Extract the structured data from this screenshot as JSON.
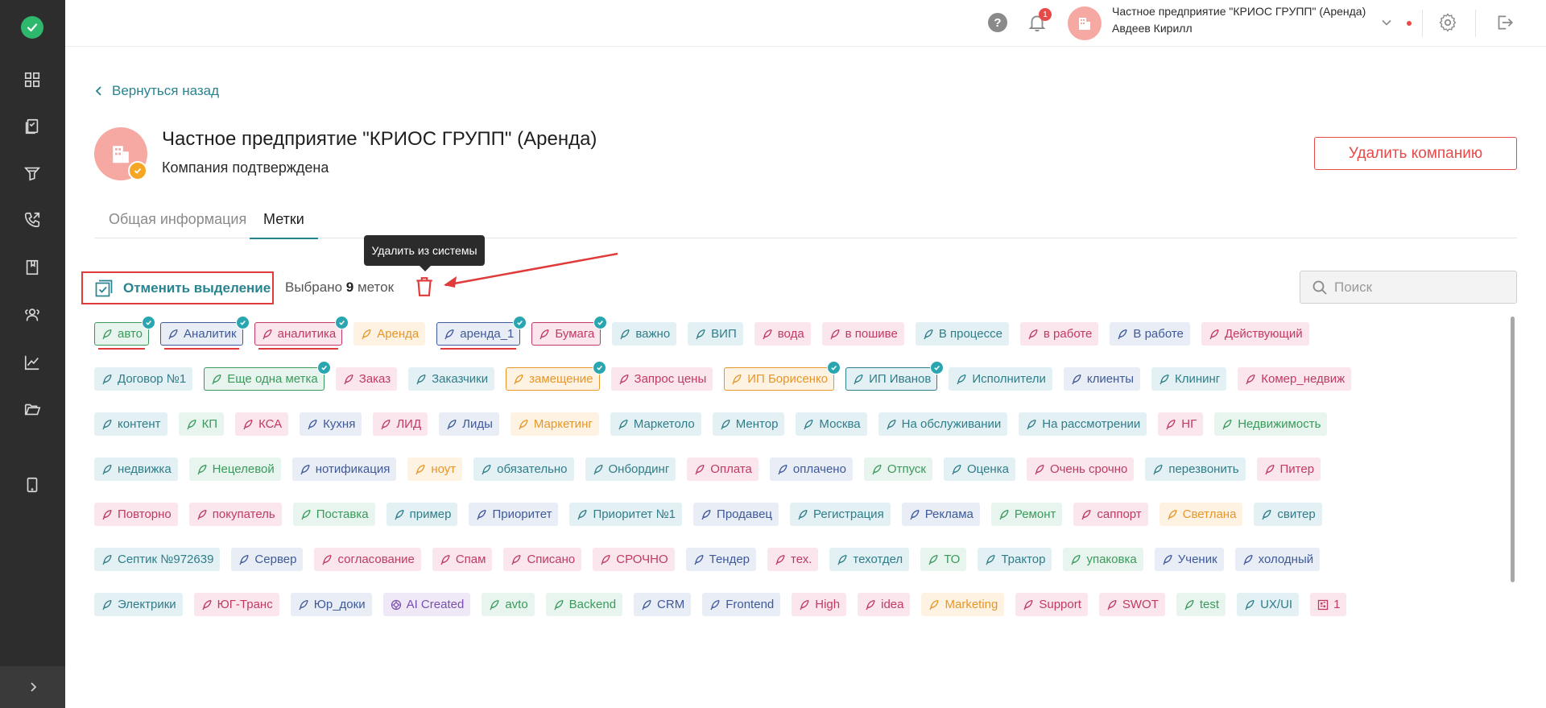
{
  "header": {
    "company_name": "Частное предприятие \"КРИОС ГРУПП\" (Аренда)",
    "user_name": "Авдеев Кирилл",
    "notification_count": "1",
    "help_label": "?"
  },
  "sidebar": {
    "icons": [
      "dashboard-icon",
      "documents-icon",
      "filter-icon",
      "phone-icon",
      "book-icon",
      "users-icon",
      "analytics-icon",
      "folder-icon",
      "mobile-icon"
    ]
  },
  "page": {
    "back_label": "Вернуться назад",
    "title": "Частное предприятие \"КРИОС ГРУПП\" (Аренда)",
    "status": "Компания подтверждена",
    "delete_company_label": "Удалить компанию",
    "tabs": [
      {
        "label": "Общая информация",
        "active": false
      },
      {
        "label": "Метки",
        "active": true
      }
    ],
    "cancel_selection_label": "Отменить выделение",
    "selected_prefix": "Выбрано ",
    "selected_count": "9",
    "selected_suffix": " меток",
    "tooltip": "Удалить из системы",
    "search_placeholder": "Поиск"
  },
  "colors": {
    "accent": "#27838f",
    "danger": "#e84a4a",
    "sidebar": "#2d2d2d",
    "success": "#2eb86e"
  },
  "tags": [
    [
      {
        "label": "авто",
        "color": "green",
        "selected": true,
        "underline": true
      },
      {
        "label": "Аналитик",
        "color": "blue",
        "selected": true,
        "underline": true
      },
      {
        "label": "аналитика",
        "color": "pink",
        "selected": true,
        "underline": true
      },
      {
        "label": "Аренда",
        "color": "orange"
      },
      {
        "label": "аренда_1",
        "color": "blue",
        "selected": true,
        "underline": true
      },
      {
        "label": "Бумага",
        "color": "pink",
        "selected": true
      },
      {
        "label": "важно",
        "color": "teal"
      },
      {
        "label": "ВИП",
        "color": "teal"
      },
      {
        "label": "вода",
        "color": "pink"
      },
      {
        "label": "в пошиве",
        "color": "pink"
      },
      {
        "label": "В процессе",
        "color": "teal"
      },
      {
        "label": "в работе",
        "color": "pink"
      },
      {
        "label": "В работе",
        "color": "blue"
      },
      {
        "label": "Действующий",
        "color": "pink"
      }
    ],
    [
      {
        "label": "Договор №1",
        "color": "teal"
      },
      {
        "label": "Еще одна метка",
        "color": "green",
        "selected": true
      },
      {
        "label": "Заказ",
        "color": "pink"
      },
      {
        "label": "Заказчики",
        "color": "teal"
      },
      {
        "label": "замещение",
        "color": "orange",
        "selected": true
      },
      {
        "label": "Запрос цены",
        "color": "pink"
      },
      {
        "label": "ИП Борисенко",
        "color": "orange",
        "selected": true
      },
      {
        "label": "ИП Иванов",
        "color": "teal",
        "selected": true
      },
      {
        "label": "Исполнители",
        "color": "teal"
      },
      {
        "label": "клиенты",
        "color": "blue"
      },
      {
        "label": "Клининг",
        "color": "teal"
      },
      {
        "label": "Комер_недвиж",
        "color": "pink"
      }
    ],
    [
      {
        "label": "контент",
        "color": "teal"
      },
      {
        "label": "КП",
        "color": "green"
      },
      {
        "label": "КСА",
        "color": "pink"
      },
      {
        "label": "Кухня",
        "color": "blue"
      },
      {
        "label": "ЛИД",
        "color": "pink"
      },
      {
        "label": "Лиды",
        "color": "blue"
      },
      {
        "label": "Маркетинг",
        "color": "orange"
      },
      {
        "label": "Маркетоло",
        "color": "teal"
      },
      {
        "label": "Ментор",
        "color": "teal"
      },
      {
        "label": "Москва",
        "color": "teal"
      },
      {
        "label": "На обслуживании",
        "color": "teal"
      },
      {
        "label": "На рассмотрении",
        "color": "teal"
      },
      {
        "label": "НГ",
        "color": "pink"
      },
      {
        "label": "Недвижимость",
        "color": "green"
      }
    ],
    [
      {
        "label": "недвижка",
        "color": "teal"
      },
      {
        "label": "Нецелевой",
        "color": "green"
      },
      {
        "label": "нотификация",
        "color": "blue"
      },
      {
        "label": "ноут",
        "color": "orange"
      },
      {
        "label": "обязательно",
        "color": "teal"
      },
      {
        "label": "Онбординг",
        "color": "teal"
      },
      {
        "label": "Оплата",
        "color": "pink"
      },
      {
        "label": "оплачено",
        "color": "blue"
      },
      {
        "label": "Отпуск",
        "color": "green"
      },
      {
        "label": "Оценка",
        "color": "teal"
      },
      {
        "label": "Очень срочно",
        "color": "pink"
      },
      {
        "label": "перезвонить",
        "color": "teal"
      },
      {
        "label": "Питер",
        "color": "pink"
      }
    ],
    [
      {
        "label": "Повторно",
        "color": "pink"
      },
      {
        "label": "покупатель",
        "color": "pink"
      },
      {
        "label": "Поставка",
        "color": "green"
      },
      {
        "label": "пример",
        "color": "teal"
      },
      {
        "label": "Приоритет",
        "color": "blue"
      },
      {
        "label": "Приоритет №1",
        "color": "teal"
      },
      {
        "label": "Продавец",
        "color": "blue"
      },
      {
        "label": "Регистрация",
        "color": "teal"
      },
      {
        "label": "Реклама",
        "color": "blue"
      },
      {
        "label": "Ремонт",
        "color": "green"
      },
      {
        "label": "саппорт",
        "color": "pink"
      },
      {
        "label": "Светлана",
        "color": "orange"
      },
      {
        "label": "свитер",
        "color": "teal"
      }
    ],
    [
      {
        "label": "Септик №972639",
        "color": "teal"
      },
      {
        "label": "Сервер",
        "color": "blue"
      },
      {
        "label": "согласование",
        "color": "pink"
      },
      {
        "label": "Спам",
        "color": "pink"
      },
      {
        "label": "Списано",
        "color": "pink"
      },
      {
        "label": "СРОЧНО",
        "color": "pink"
      },
      {
        "label": "Тендер",
        "color": "blue"
      },
      {
        "label": "тех.",
        "color": "pink"
      },
      {
        "label": "техотдел",
        "color": "teal"
      },
      {
        "label": "ТО",
        "color": "green"
      },
      {
        "label": "Трактор",
        "color": "teal"
      },
      {
        "label": "упаковка",
        "color": "green"
      },
      {
        "label": "Ученик",
        "color": "blue"
      },
      {
        "label": "холодный",
        "color": "blue"
      }
    ],
    [
      {
        "label": "Электрики",
        "color": "teal"
      },
      {
        "label": "ЮГ-Транс",
        "color": "pink"
      },
      {
        "label": "Юр_доки",
        "color": "blue"
      },
      {
        "label": "AI Created",
        "color": "purple",
        "icon": "ai"
      },
      {
        "label": "avto",
        "color": "green"
      },
      {
        "label": "Backend",
        "color": "green"
      },
      {
        "label": "CRM",
        "color": "blue"
      },
      {
        "label": "Frontend",
        "color": "blue"
      },
      {
        "label": "High",
        "color": "pink"
      },
      {
        "label": "idea",
        "color": "pink"
      },
      {
        "label": "Marketing",
        "color": "orange"
      },
      {
        "label": "Support",
        "color": "pink"
      },
      {
        "label": "SWOT",
        "color": "pink"
      },
      {
        "label": "test",
        "color": "green"
      },
      {
        "label": "UX/UI",
        "color": "teal"
      },
      {
        "label": "1",
        "color": "pink",
        "icon": "grid"
      }
    ]
  ]
}
